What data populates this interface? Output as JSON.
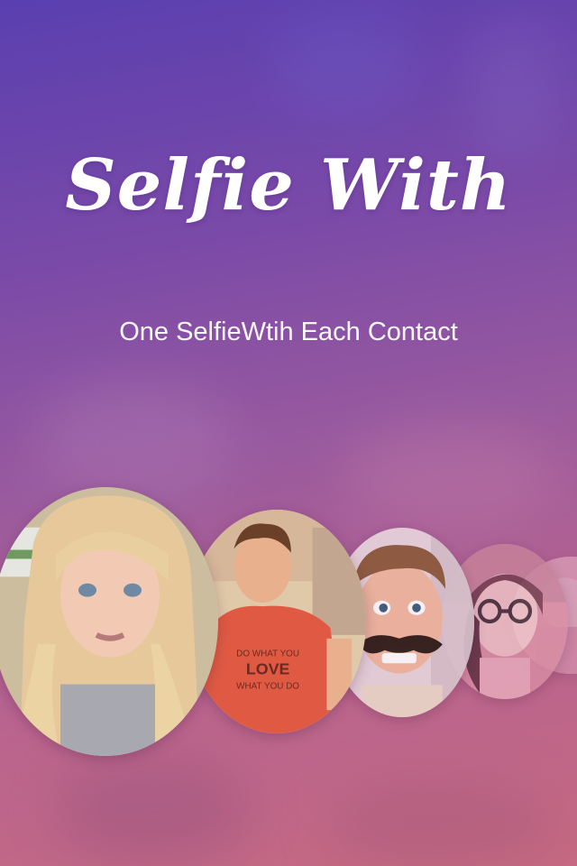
{
  "app": {
    "title": "Selfie With",
    "tagline": "One SelfieWtih Each Contact"
  },
  "colors": {
    "background_top": "#5a3fb0",
    "background_bottom": "#c76a82",
    "text": "#ffffff"
  },
  "avatars": [
    {
      "id": "contact-1",
      "description_icon": "woman-blonde-avatar"
    },
    {
      "id": "contact-2",
      "description_icon": "man-red-shirt-avatar"
    },
    {
      "id": "contact-3",
      "description_icon": "man-mustache-avatar"
    },
    {
      "id": "contact-4",
      "description_icon": "woman-glasses-avatar"
    },
    {
      "id": "contact-5",
      "description_icon": "faded-contact-avatar"
    }
  ],
  "graphic_text": {
    "shirt_lines": [
      "DO WHAT YOU",
      "LOVE",
      "WHAT YOU DO"
    ]
  }
}
